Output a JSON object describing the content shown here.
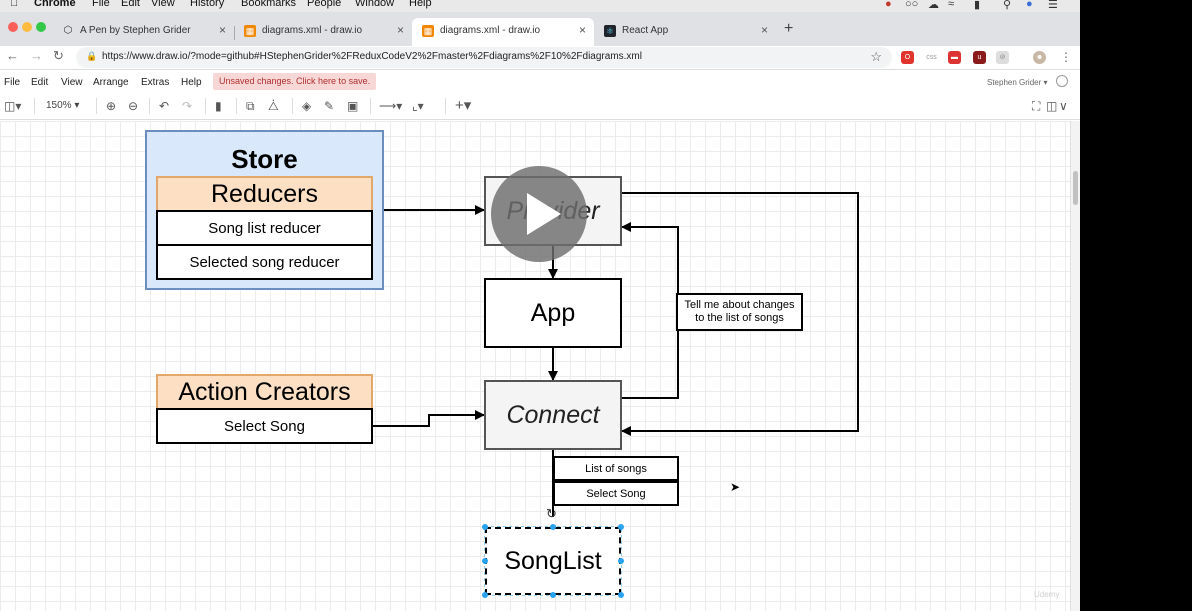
{
  "menubar": {
    "app": "Chrome",
    "items": [
      "File",
      "Edit",
      "View",
      "History",
      "Bookmarks",
      "People",
      "Window",
      "Help"
    ]
  },
  "tabs": [
    {
      "title": "A Pen by Stephen Grider",
      "icon": "codepen-icon",
      "active": false
    },
    {
      "title": "diagrams.xml - draw.io",
      "icon": "drawio-icon",
      "active": false
    },
    {
      "title": "diagrams.xml - draw.io",
      "icon": "drawio-icon",
      "active": true
    },
    {
      "title": "React App",
      "icon": "react-icon",
      "active": false
    }
  ],
  "address": {
    "url": "https://www.draw.io/?mode=github#HStephenGrider%2FReduxCodeV2%2Fmaster%2Fdiagrams%2F10%2Fdiagrams.xml"
  },
  "drawio_menu": {
    "items": [
      "File",
      "Edit",
      "View",
      "Arrange",
      "Extras",
      "Help"
    ],
    "unsaved": "Unsaved changes. Click here to save.",
    "user": "Stephen Grider"
  },
  "toolbar": {
    "zoom": "150%"
  },
  "diagram": {
    "store_title": "Store",
    "reducers_title": "Reducers",
    "reducer_1": "Song list reducer",
    "reducer_2": "Selected song reducer",
    "provider": "Provider",
    "app": "App",
    "connect": "Connect",
    "note_line1": "Tell me about changes",
    "note_line2": "to the list of songs",
    "action_creators_title": "Action Creators",
    "action_1": "Select Song",
    "prop_1": "List of songs",
    "prop_2": "Select Song",
    "songlist": "SongList"
  },
  "watermark": "Udemy",
  "colors": {
    "store_fill": "#dae8fc",
    "store_border": "#6c8ebf",
    "orange_fill": "#fde0c4",
    "selection": "#29a3f0"
  }
}
